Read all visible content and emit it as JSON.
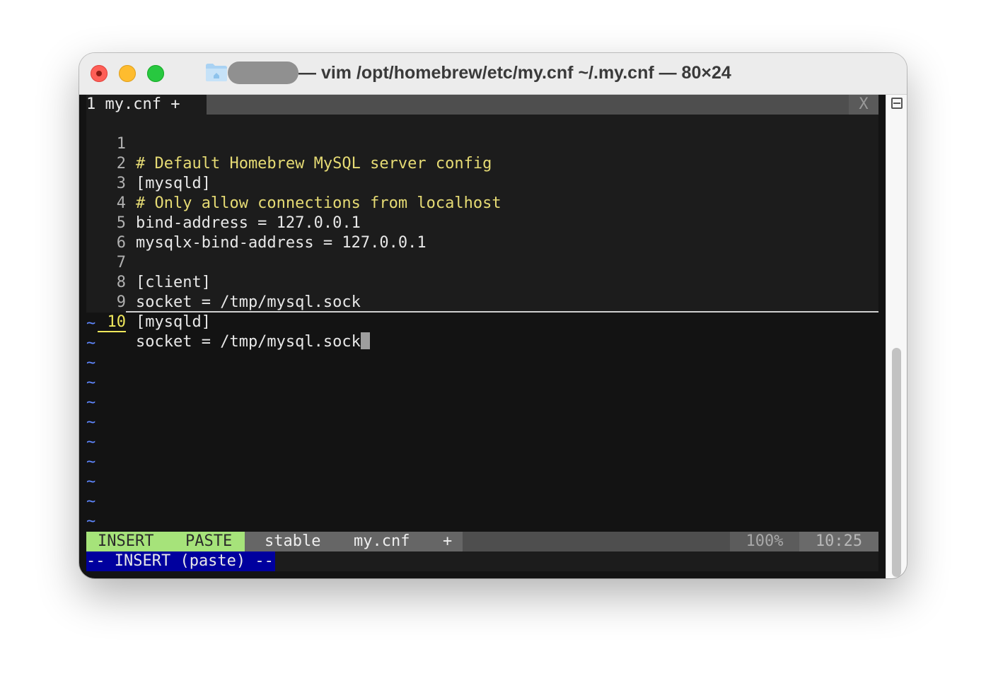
{
  "window": {
    "title": "— vim /opt/homebrew/etc/my.cnf ~/.my.cnf — 80×24"
  },
  "tabline": {
    "active_tab": "1 my.cnf +",
    "close": "X"
  },
  "buffer": {
    "lines": [
      {
        "num": "1",
        "text": "# Default Homebrew MySQL server config"
      },
      {
        "num": "2",
        "text": "[mysqld]"
      },
      {
        "num": "3",
        "text": "# Only allow connections from localhost"
      },
      {
        "num": "4",
        "text": "bind-address = 127.0.0.1"
      },
      {
        "num": "5",
        "text": "mysqlx-bind-address = 127.0.0.1"
      },
      {
        "num": "6",
        "text": ""
      },
      {
        "num": "7",
        "text": "[client]"
      },
      {
        "num": "8",
        "text": "socket = /tmp/mysql.sock"
      },
      {
        "num": "9",
        "text": "[mysqld]"
      },
      {
        "num": "10",
        "text": "socket = /tmp/mysql.sock"
      }
    ],
    "empty_marker": "~"
  },
  "statusline": {
    "mode": "INSERT",
    "paste": "PASTE",
    "branch": "stable",
    "file": "my.cnf",
    "modified": "+",
    "percent": "100%",
    "position": "10:25"
  },
  "cmdline": {
    "message": "-- INSERT (paste) --"
  },
  "colors": {
    "comment": "#e6db74",
    "tilde": "#5f87ff",
    "mode_bg": "#a6e37a",
    "cmd_bg": "#00009e",
    "current_line_number": "#f0e85c"
  }
}
